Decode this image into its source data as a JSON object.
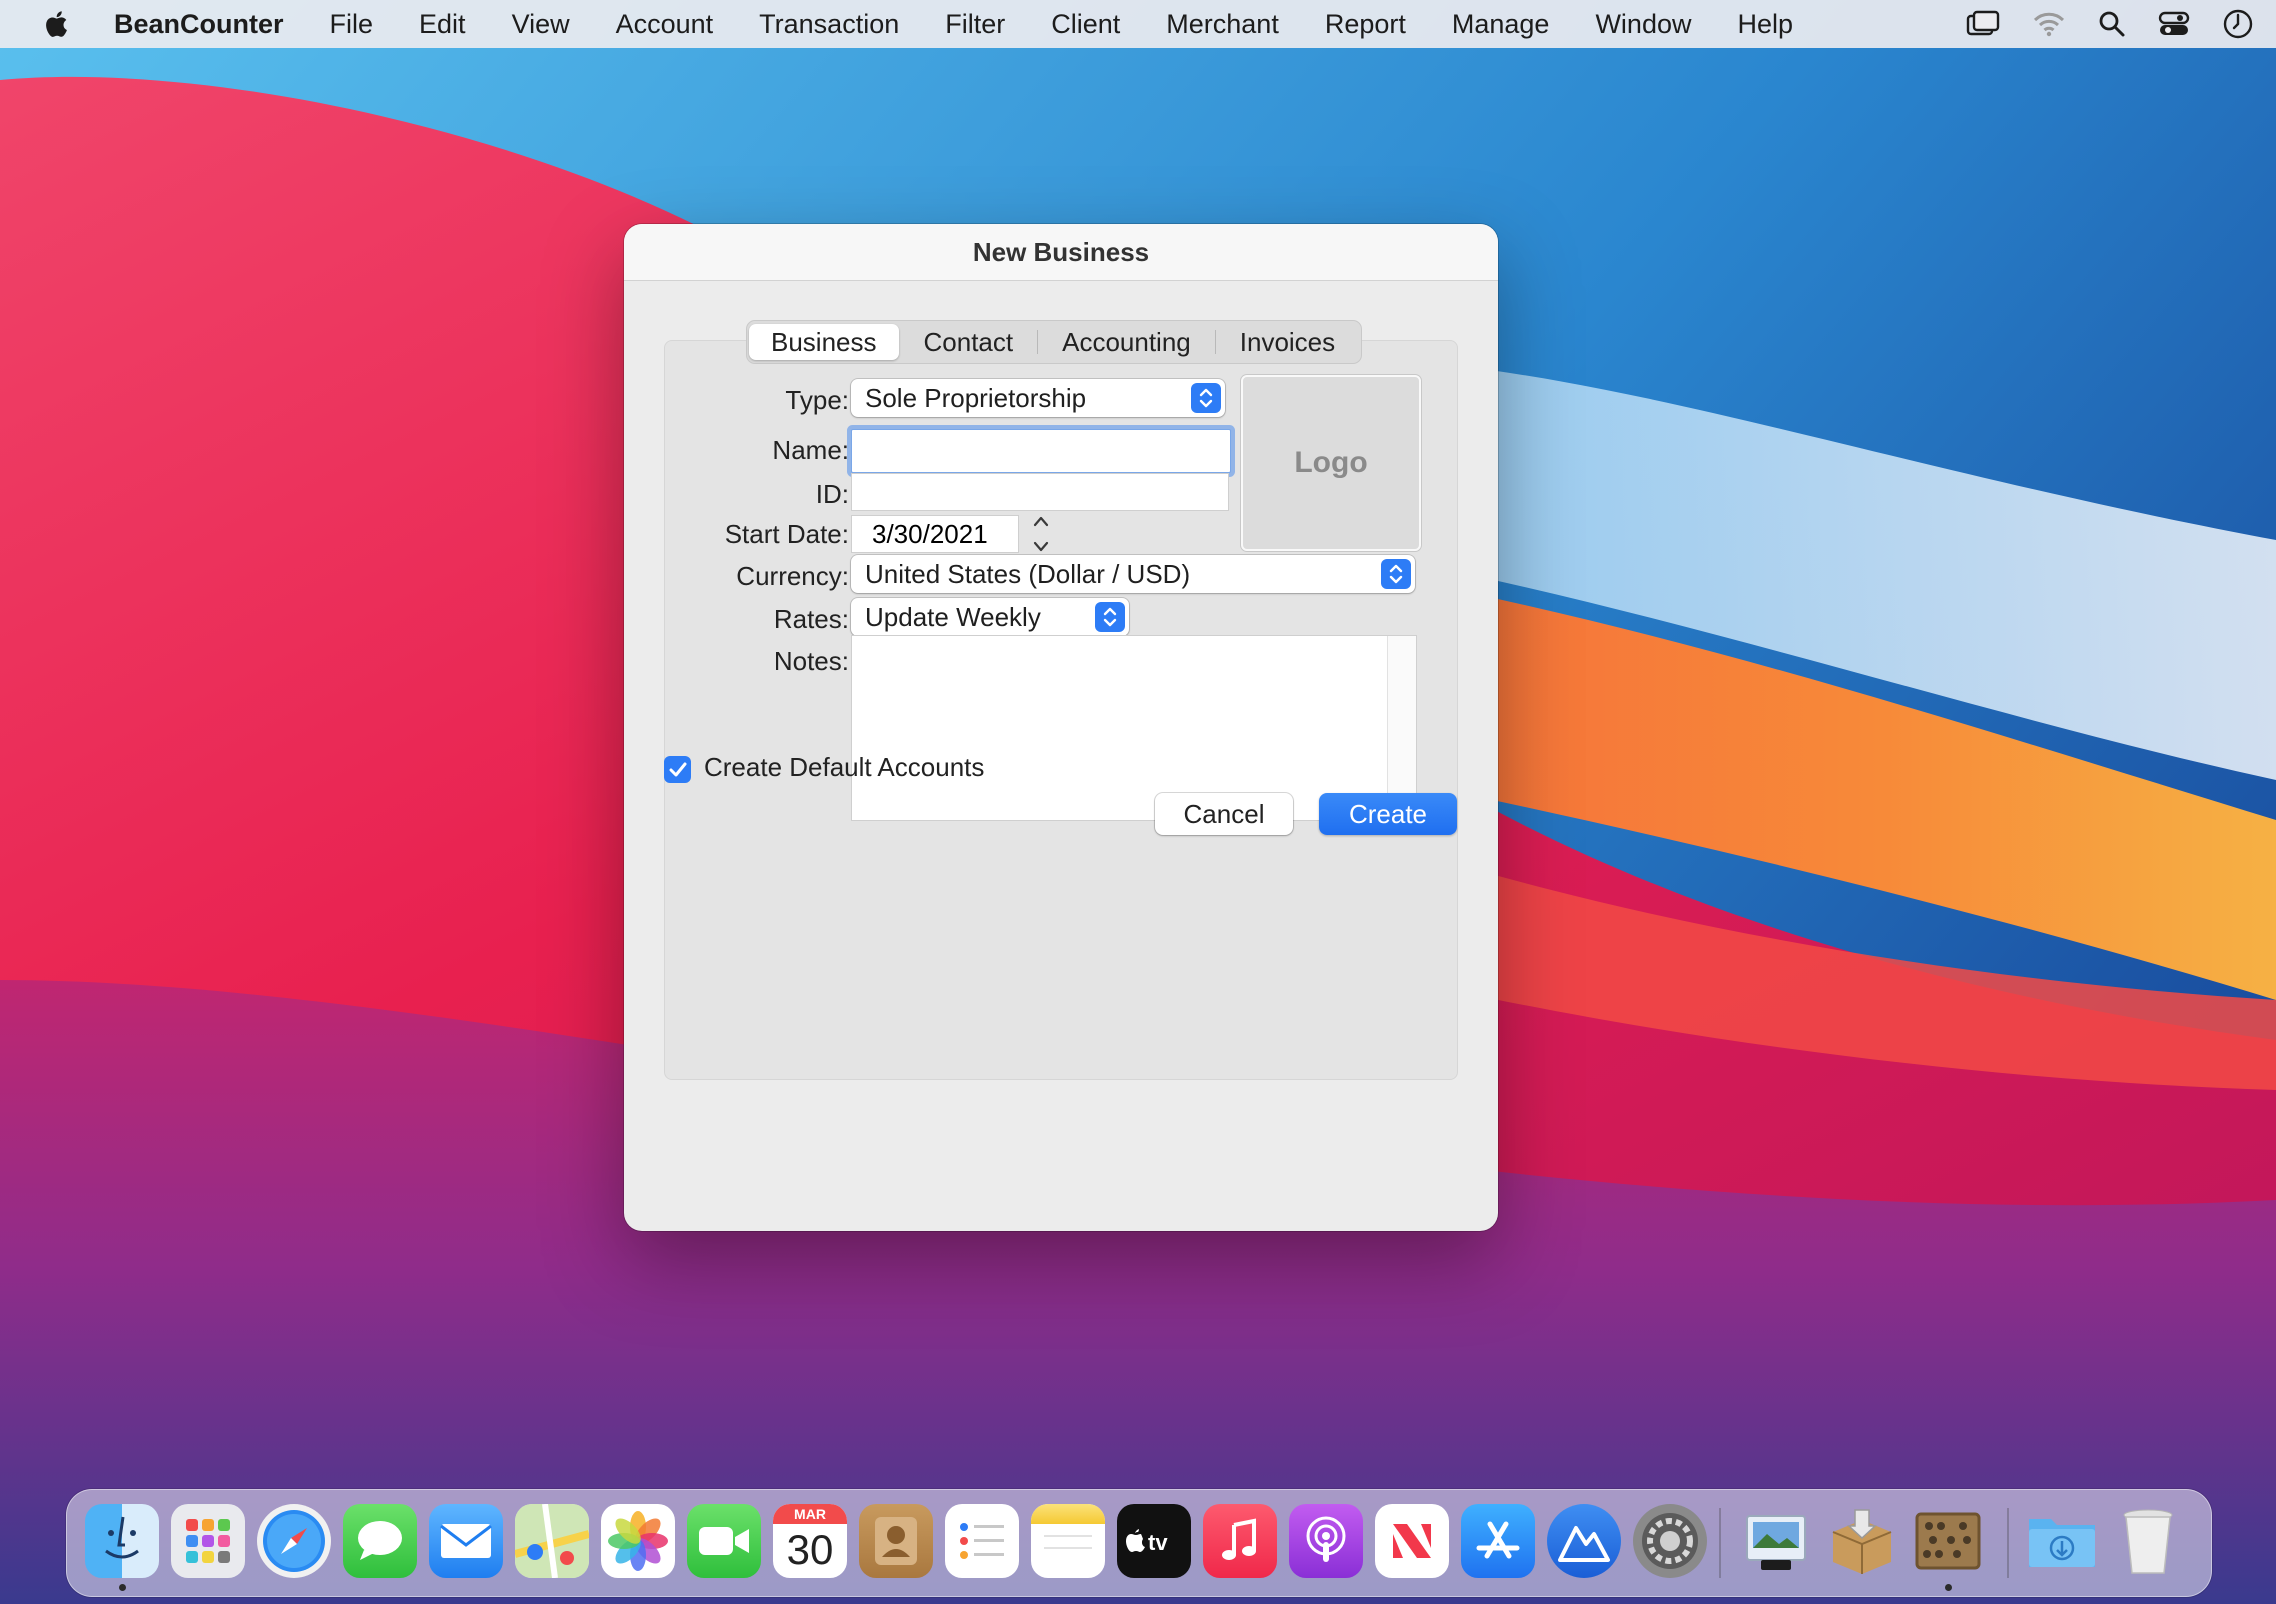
{
  "menubar": {
    "app_name": "BeanCounter",
    "items": [
      "File",
      "Edit",
      "View",
      "Account",
      "Transaction",
      "Filter",
      "Client",
      "Merchant",
      "Report",
      "Manage",
      "Window",
      "Help"
    ],
    "status_icons": [
      "screen-mirroring-icon",
      "wifi-icon",
      "spotlight-search-icon",
      "control-center-icon",
      "clock-icon"
    ]
  },
  "dialog": {
    "title": "New Business",
    "tabs": [
      "Business",
      "Contact",
      "Accounting",
      "Invoices"
    ],
    "active_tab": "Business",
    "labels": {
      "type": "Type:",
      "name": "Name:",
      "id": "ID:",
      "start_date": "Start Date:",
      "currency": "Currency:",
      "rates": "Rates:",
      "notes": "Notes:"
    },
    "fields": {
      "type": "Sole Proprietorship",
      "name": "",
      "id": "",
      "start_date": "3/30/2021",
      "currency": "United States (Dollar / USD)",
      "rates": "Update Weekly",
      "notes": ""
    },
    "logo_label": "Logo",
    "checkbox": {
      "label": "Create Default Accounts",
      "checked": true
    },
    "buttons": {
      "cancel": "Cancel",
      "create": "Create"
    },
    "accent_color": "#2d7cf6"
  },
  "dock": {
    "calendar": {
      "month": "MAR",
      "day": "30"
    },
    "apps": [
      "Finder",
      "Launchpad",
      "Safari",
      "Messages",
      "Mail",
      "Maps",
      "Photos",
      "FaceTime",
      "Calendar",
      "Contacts",
      "Reminders",
      "Notes",
      "TV",
      "Music",
      "Podcasts",
      "News",
      "App Store",
      "Transporter",
      "System Preferences",
      "Preview",
      "Installer",
      "BeanCounter",
      "Downloads",
      "Trash"
    ]
  }
}
